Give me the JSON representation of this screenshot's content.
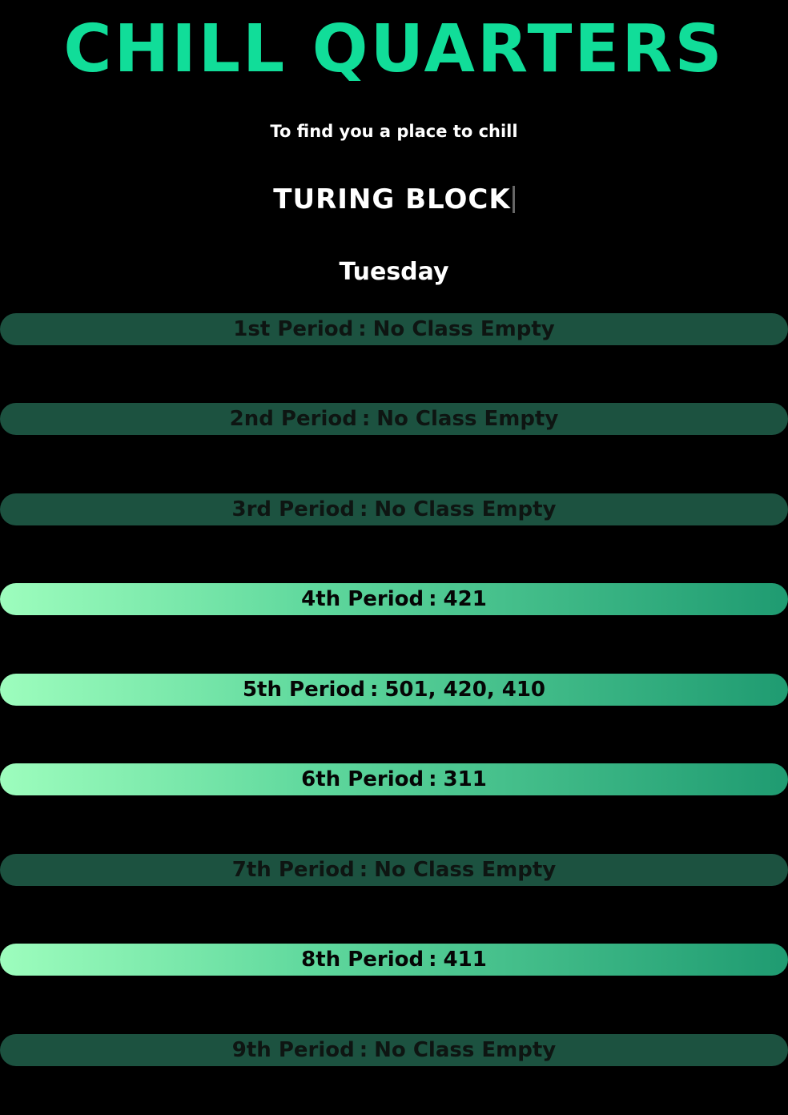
{
  "header": {
    "title": "CHILL QUARTERS",
    "subtitle": "To find you a place to chill"
  },
  "block": {
    "name": "TURING BLOCK"
  },
  "day": "Tuesday",
  "colors": {
    "title": "#11dd99",
    "empty_bar": "#1c5240",
    "available_gradient_start": "#9dfdbd",
    "available_gradient_end": "#1f9b71"
  },
  "periods": [
    {
      "label": "1st Period",
      "separator": ":",
      "value": "No Class Empty",
      "status": "empty"
    },
    {
      "label": "2nd Period",
      "separator": ":",
      "value": "No Class Empty",
      "status": "empty"
    },
    {
      "label": "3rd Period",
      "separator": ":",
      "value": "No Class Empty",
      "status": "empty"
    },
    {
      "label": "4th Period",
      "separator": ":",
      "value": "421",
      "status": "available"
    },
    {
      "label": "5th Period",
      "separator": ":",
      "value": "501, 420, 410",
      "status": "available"
    },
    {
      "label": "6th Period",
      "separator": ":",
      "value": "311",
      "status": "available"
    },
    {
      "label": "7th Period",
      "separator": ":",
      "value": "No Class Empty",
      "status": "empty"
    },
    {
      "label": "8th Period",
      "separator": ":",
      "value": "411",
      "status": "available"
    },
    {
      "label": "9th Period",
      "separator": ":",
      "value": "No Class Empty",
      "status": "empty"
    }
  ]
}
